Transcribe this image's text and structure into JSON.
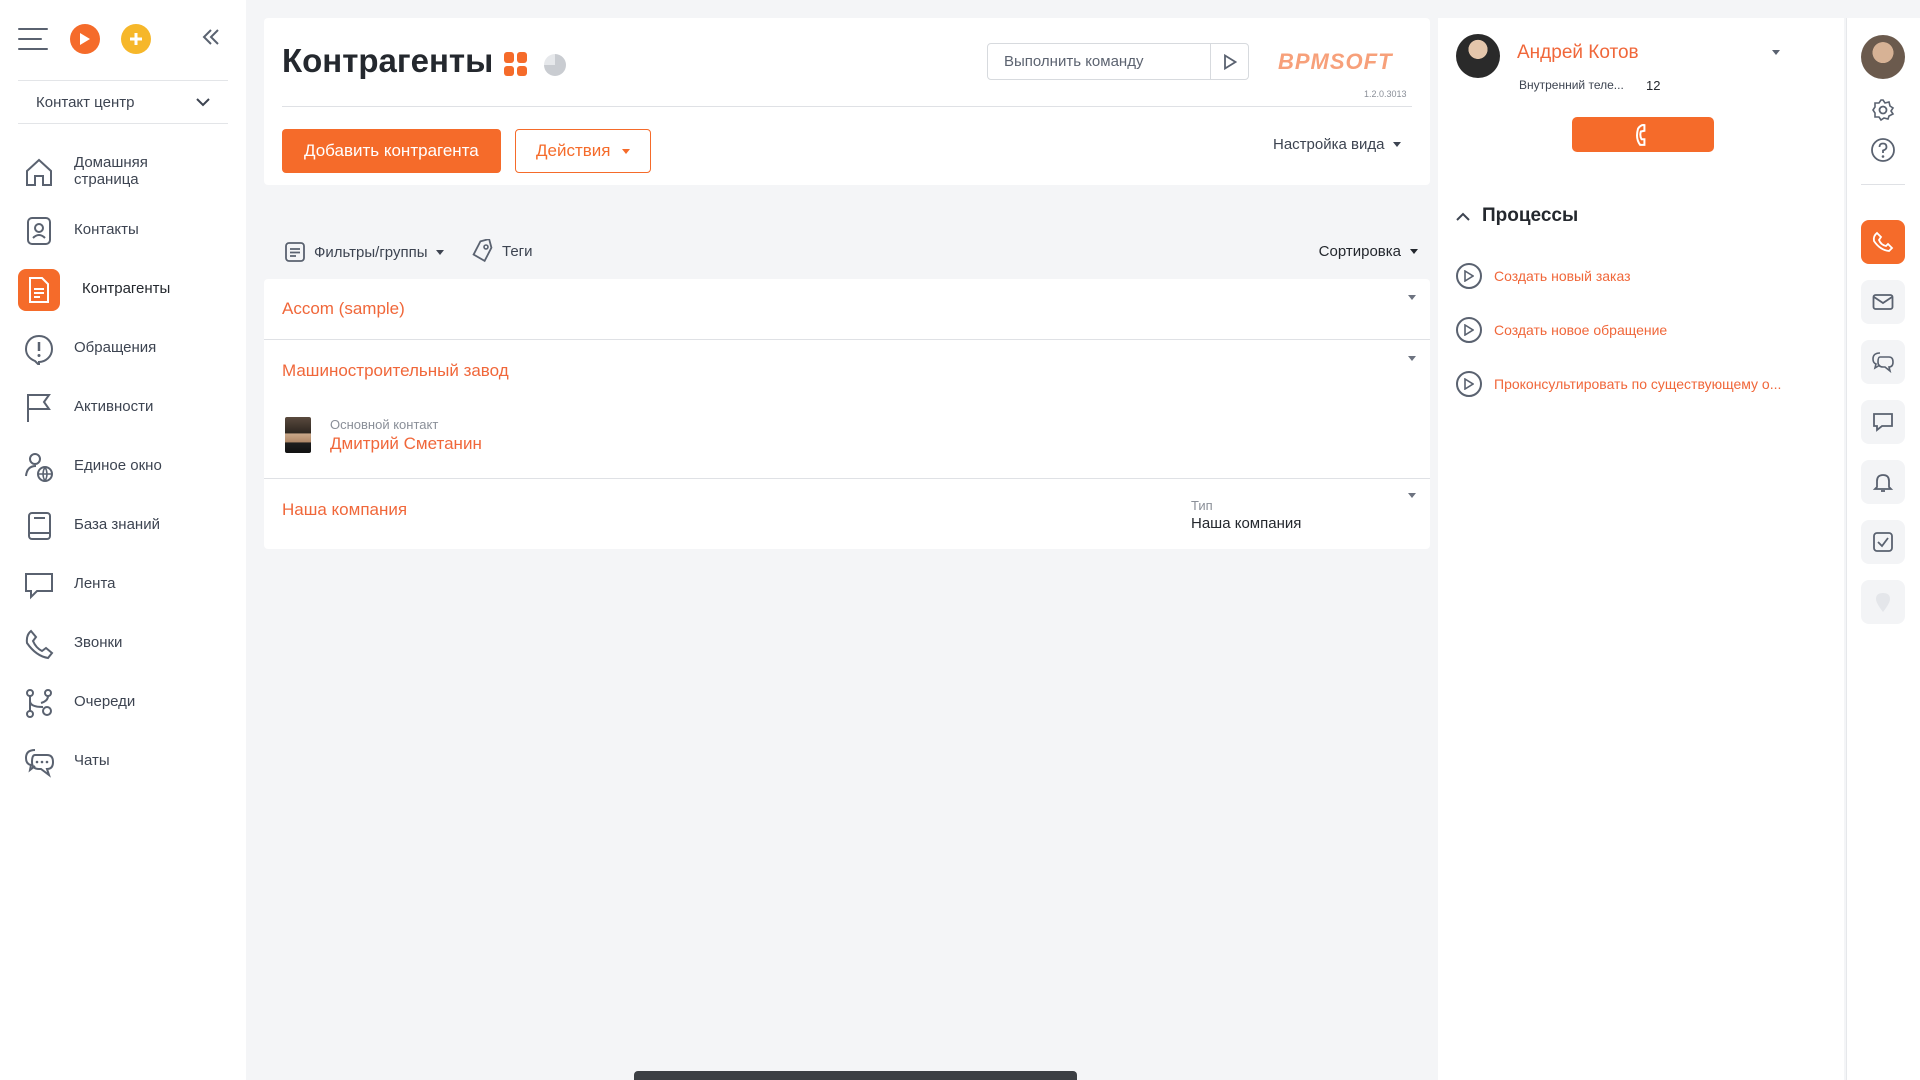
{
  "colors": {
    "accent": "#f56b2a",
    "accent_text": "#f0673a",
    "add_button": "#f6b72a",
    "background": "#f4f5f7"
  },
  "sidebar": {
    "workspace": "Контакт центр",
    "items": [
      {
        "label": "Домашняя страница",
        "icon": "home-icon"
      },
      {
        "label": "Контакты",
        "icon": "contact-icon"
      },
      {
        "label": "Контрагенты",
        "icon": "document-icon",
        "active": true
      },
      {
        "label": "Обращения",
        "icon": "alert-icon"
      },
      {
        "label": "Активности",
        "icon": "flag-icon"
      },
      {
        "label": "Единое окно",
        "icon": "globe-user-icon"
      },
      {
        "label": "База знаний",
        "icon": "book-icon"
      },
      {
        "label": "Лента",
        "icon": "speech-bubble-icon"
      },
      {
        "label": "Звонки",
        "icon": "phone-icon"
      },
      {
        "label": "Очереди",
        "icon": "queue-icon"
      },
      {
        "label": "Чаты",
        "icon": "chat-icon"
      }
    ]
  },
  "header": {
    "title": "Контрагенты",
    "command_placeholder": "Выполнить команду",
    "logo": "BPMSOFT",
    "version": "1.2.0.3013",
    "add_button": "Добавить контрагента",
    "actions_button": "Действия",
    "view_settings": "Настройка вида"
  },
  "filter_bar": {
    "filters": "Фильтры/группы",
    "tags": "Теги",
    "sorting": "Сортировка"
  },
  "list": {
    "rows": [
      {
        "title": "Accom (sample)"
      },
      {
        "title": "Машиностроительный завод",
        "contact_label": "Основной контакт",
        "contact_name": "Дмитрий Сметанин"
      },
      {
        "title": "Наша компания",
        "type_label": "Тип",
        "type_value": "Наша компания"
      }
    ]
  },
  "right_panel": {
    "user_name": "Андрей Котов",
    "ext_label": "Внутренний теле...",
    "ext_value": "12",
    "processes_title": "Процессы",
    "processes": [
      "Создать новый заказ",
      "Создать новое обращение",
      "Проконсультировать по существующему о..."
    ]
  },
  "right_strip": {
    "icons": [
      "settings-icon",
      "help-icon",
      "phone-icon",
      "email-icon",
      "chat-icon",
      "feed-icon",
      "bell-icon",
      "task-icon",
      "location-icon"
    ]
  }
}
